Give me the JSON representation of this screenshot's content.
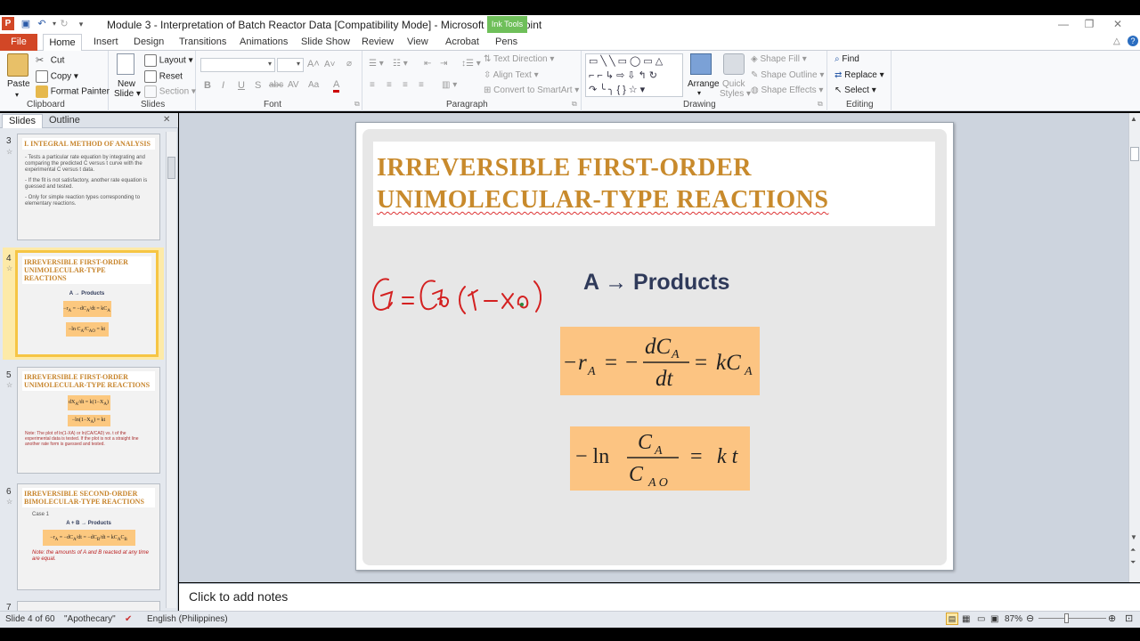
{
  "window": {
    "title": "Module 3 - Interpretation of Batch Reactor Data [Compatibility Mode]  -  Microsoft PowerPoint",
    "contextual_tab_group": "Ink Tools"
  },
  "ribbon_tabs": {
    "file": "File",
    "home": "Home",
    "insert": "Insert",
    "design": "Design",
    "transitions": "Transitions",
    "animations": "Animations",
    "slide_show": "Slide Show",
    "review": "Review",
    "view": "View",
    "acrobat": "Acrobat",
    "pens": "Pens"
  },
  "clipboard": {
    "label": "Clipboard",
    "paste": "Paste",
    "cut": "Cut",
    "copy": "Copy",
    "format_painter": "Format Painter"
  },
  "slides_group": {
    "label": "Slides",
    "new_slide": "New",
    "new_slide2": "Slide",
    "layout": "Layout",
    "reset": "Reset",
    "section": "Section"
  },
  "font_group": {
    "label": "Font"
  },
  "paragraph_group": {
    "label": "Paragraph",
    "text_direction": "Text Direction",
    "align_text": "Align Text",
    "convert_smartart": "Convert to SmartArt"
  },
  "drawing_group": {
    "label": "Drawing",
    "arrange": "Arrange",
    "quick_styles": "Quick",
    "quick_styles2": "Styles",
    "shape_fill": "Shape Fill",
    "shape_outline": "Shape Outline",
    "shape_effects": "Shape Effects"
  },
  "editing_group": {
    "label": "Editing",
    "find": "Find",
    "replace": "Replace",
    "select": "Select"
  },
  "pane_tabs": {
    "slides": "Slides",
    "outline": "Outline"
  },
  "thumbnails": [
    {
      "num": "3",
      "title": "I. INTEGRAL METHOD OF ANALYSIS",
      "b1": "- Tests a particular rate equation by integrating and comparing the predicted C versus t curve with the experimental C versus t data.",
      "b2": "- If the fit is not satisfactory, another rate equation is guessed and tested.",
      "b3": "- Only for simple reaction types corresponding to elementary reactions."
    },
    {
      "num": "4",
      "title": "IRREVERSIBLE FIRST-ORDER UNIMOLECULAR-TYPE REACTIONS",
      "sub": "A → Products"
    },
    {
      "num": "5",
      "title": "IRREVERSIBLE FIRST-ORDER UNIMOLECULAR-TYPE REACTIONS",
      "note": "Note: The plot of ln(1-XA) or ln(CA/CA0) vs. t of the experimental data is tested. If the plot is not a straight line another rate form is guessed and tested."
    },
    {
      "num": "6",
      "title": "IRREVERSIBLE SECOND-ORDER BIMOLECULAR-TYPE REACTIONS",
      "case": "Case 1",
      "sub": "A + B → Products",
      "note": "Note: the amounts of A and B reacted at any time are equal."
    },
    {
      "num": "7"
    }
  ],
  "slide": {
    "title_line1": "IRREVERSIBLE FIRST-ORDER",
    "title_line2": "UNIMOLECULAR-TYPE REACTIONS",
    "reaction": "A → Products",
    "handwriting": "CA = CA0 (1 - XA)"
  },
  "notes": {
    "placeholder": "Click to add notes"
  },
  "status": {
    "slide_info": "Slide 4 of 60",
    "theme": "\"Apothecary\"",
    "language": "English (Philippines)",
    "zoom": "87%"
  },
  "colors": {
    "file_tab": "#d24726",
    "title_text": "#c88a2c",
    "equation_fill": "#fcc482",
    "selected_thumb": "#f6c544"
  }
}
